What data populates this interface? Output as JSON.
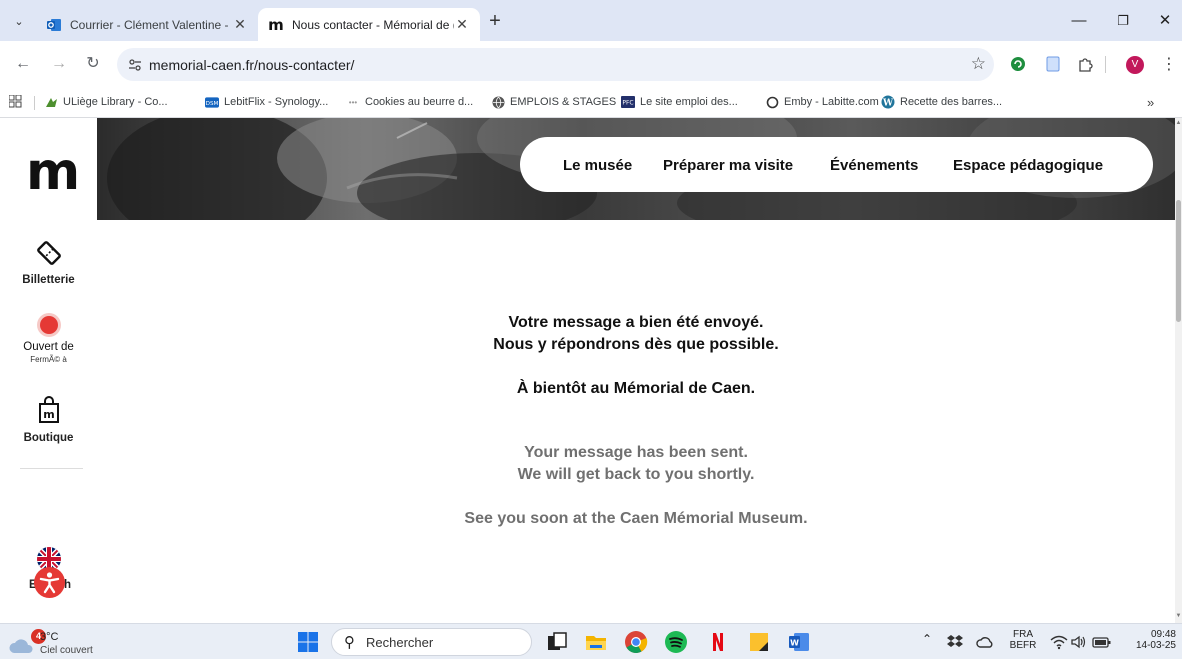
{
  "browser": {
    "tabs": [
      {
        "title": "Courrier - Clément Valentine - (",
        "active": false
      },
      {
        "title": "Nous contacter - Mémorial de (",
        "active": true
      }
    ],
    "tab_close_glyph": "✕",
    "new_tab_glyph": "+",
    "window": {
      "minimize": "—",
      "restore": "❐",
      "close": "✕"
    },
    "url": "memorial-caen.fr/nous-contacter/",
    "profile_initial": "V",
    "bookmarks": [
      {
        "label": "ULiège Library - Co...",
        "icon": "uliege-icon"
      },
      {
        "label": "LebitFlix - Synology...",
        "icon": "dsm-icon"
      },
      {
        "label": "Cookies au beurre d...",
        "icon": "cookie-site-icon"
      },
      {
        "label": "EMPLOIS & STAGES",
        "icon": "globe-icon"
      },
      {
        "label": "Le site emploi des...",
        "icon": "pfc-icon"
      },
      {
        "label": "Emby - Labitte.com",
        "icon": "emby-icon"
      },
      {
        "label": "Recette des barres...",
        "icon": "wordpress-icon"
      }
    ],
    "bookmarks_overflow": "»"
  },
  "site": {
    "logo": "m",
    "sidebar": {
      "ticketing": "Billetterie",
      "status_label": "Ouvert de",
      "status_sub": "FermÃ© à",
      "status_color": "#e53935",
      "shop": "Boutique",
      "language": "English",
      "language_partial": "E",
      "language_partial_end": "h"
    },
    "nav": [
      "Le musée",
      "Préparer ma visite",
      "Événements",
      "Espace pédagogique"
    ],
    "message_fr": {
      "line1": "Votre message a bien été envoyé.",
      "line2": "Nous y répondrons dès que possible.",
      "line3": "À bientôt au Mémorial de Caen."
    },
    "message_en": {
      "line1": "Your message has been sent.",
      "line2": "We will get back to you shortly.",
      "line3": "See you soon at the Caen Mémorial Museum."
    }
  },
  "taskbar": {
    "weather_temp": "3°C",
    "weather_desc": "Ciel couvert",
    "weather_badge": "4",
    "search_placeholder": "Rechercher",
    "lang_line1": "FRA",
    "lang_line2": "BEFR",
    "time": "09:48",
    "date": "14-03-25"
  }
}
